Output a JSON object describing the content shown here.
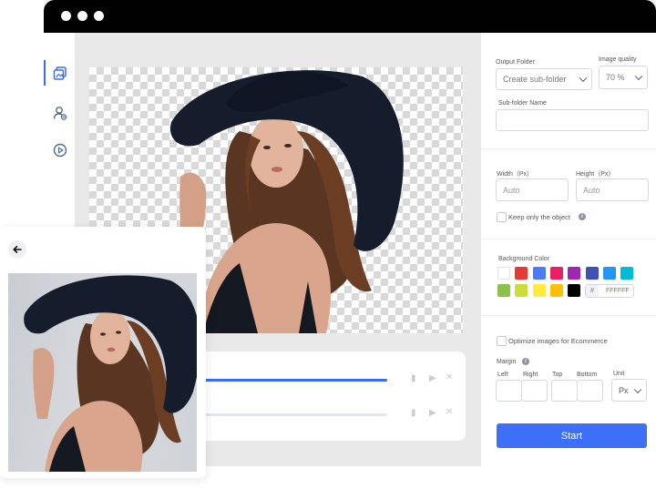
{
  "window": {
    "title_dots": 3
  },
  "sidebar": {
    "items": [
      {
        "icon": "batch-images-icon",
        "active": true
      },
      {
        "icon": "person-remove-icon",
        "active": false
      },
      {
        "icon": "play-circle-icon",
        "active": false
      }
    ]
  },
  "progress": {
    "items": [
      {
        "fraction": 1.0
      },
      {
        "fraction": 0.0
      }
    ]
  },
  "panel": {
    "output_folder": {
      "label": "Output Folder",
      "value": "Create sub-folder"
    },
    "image_quality": {
      "label": "Image quality",
      "value": "70 %"
    },
    "subfolder_name": {
      "label": "Sub-folder Name",
      "value": ""
    },
    "width": {
      "label": "Width（Px）",
      "placeholder": "Auto"
    },
    "height": {
      "label": "Height（Px）",
      "placeholder": "Auto"
    },
    "keep_only_object": {
      "label": "Keep only the object",
      "checked": false
    },
    "background_color": {
      "label": "Background Color",
      "swatches_row1": [
        "#ffffff",
        "#e53935",
        "#4a7cf7",
        "#e91e63",
        "#9c27b0",
        "#3f51b5",
        "#2196f3",
        "#00bcd4"
      ],
      "swatches_row2": [
        "#8bc34a",
        "#cddc39",
        "#ffeb3b",
        "#ffc107",
        "#000000"
      ],
      "hash": "#",
      "hex_value": "FFFFFF"
    },
    "optimize": {
      "label": "Optimize images for Ecommerce",
      "checked": false
    },
    "margin": {
      "label": "Margin",
      "left": "Left",
      "right": "Right",
      "top": "Top",
      "bottom": "Bottom",
      "unit_label": "Unit",
      "unit_value": "Px"
    },
    "start_label": "Start"
  }
}
